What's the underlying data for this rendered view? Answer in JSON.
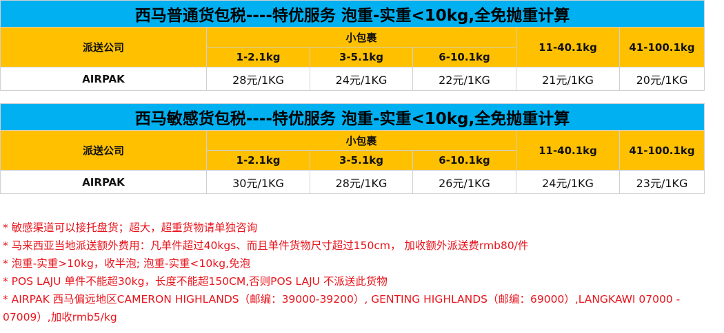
{
  "tables": [
    {
      "title": "西马普通货包税----特优服务  泡重-实重<10kg,全免抛重计算",
      "company_header": "派送公司",
      "small_parcel_header": "小包裹",
      "ranges": [
        "1-2.1kg",
        "3-5.1kg",
        "6-10.1kg",
        "11-40.1kg",
        "41-100.1kg"
      ],
      "company": "AIRPAK",
      "prices": [
        "28元/1KG",
        "24元/1KG",
        "22元/1KG",
        "21元/1KG",
        "20元/1KG"
      ]
    },
    {
      "title": "西马敏感货包税----特优服务   泡重-实重<10kg,全免抛重计算",
      "company_header": "派送公司",
      "small_parcel_header": "小包裹",
      "ranges": [
        "1-2.1kg",
        "3-5.1kg",
        "6-10.1kg",
        "11-40.1kg",
        "41-100.1kg"
      ],
      "company": "AIRPAK",
      "prices": [
        "30元/1KG",
        "28元/1KG",
        "26元/1KG",
        "24元/1KG",
        "23元/1KG"
      ]
    }
  ],
  "notes": [
    "* 敏感渠道可以接托盘货；超大，超重货物请单独咨询",
    "* 马来西亚当地派送额外费用：凡单件超过40kgs、而且单件货物尺寸超过150cm， 加收额外派送费rmb80/件",
    "* 泡重-实重>10kg，收半泡; 泡重-实重<10kg,免泡",
    "* POS LAJU 单件不能超30kg，长度不能超150CM,否则POS LAJU 不派送此货物",
    "* AIRPAK 西马偏远地区CAMERON HIGHLANDS（邮编：39000-39200）, GENTING HIGHLANDS（邮编：69000）,LANGKAWI 07000 - 07009）,加收rmb5/kg"
  ]
}
